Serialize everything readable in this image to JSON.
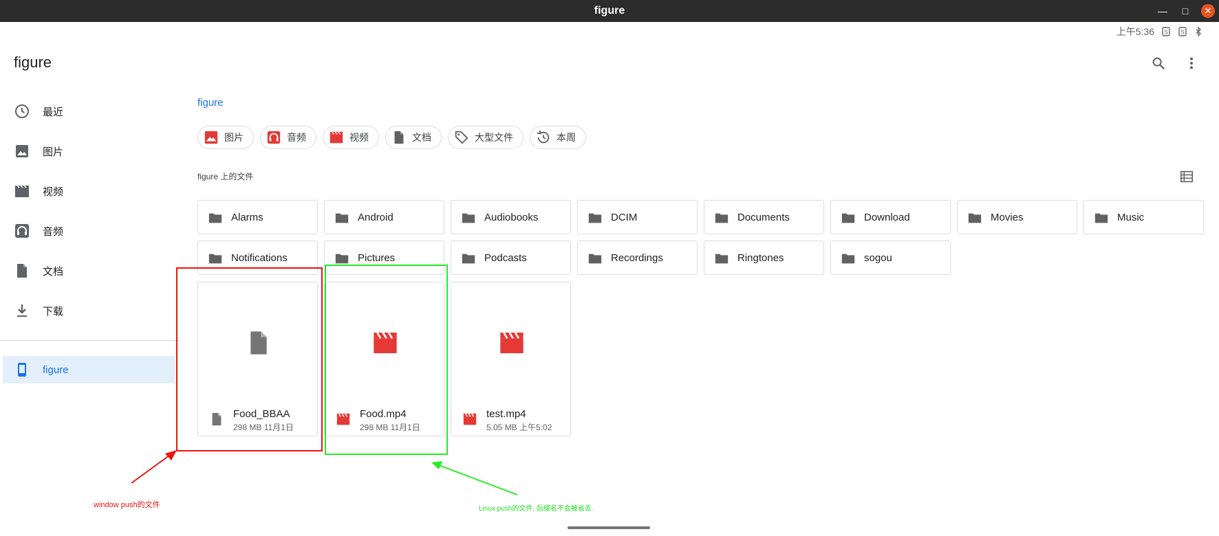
{
  "window": {
    "title": "figure"
  },
  "status": {
    "time": "上午5:36",
    "icon1": "sim-icon",
    "icon2": "sim-icon",
    "icon3": "bluetooth-icon"
  },
  "appbar": {
    "title": "figure",
    "search_icon": "search-icon",
    "more_icon": "more-vert-icon"
  },
  "sidebar": {
    "items": [
      {
        "label": "最近",
        "icon": "clock-icon"
      },
      {
        "label": "图片",
        "icon": "image-icon"
      },
      {
        "label": "视频",
        "icon": "video-icon"
      },
      {
        "label": "音频",
        "icon": "headphones-icon"
      },
      {
        "label": "文档",
        "icon": "document-icon"
      },
      {
        "label": "下载",
        "icon": "download-icon"
      }
    ],
    "device": {
      "label": "figure",
      "icon": "phone-icon"
    }
  },
  "breadcrumb": "figure",
  "chips": [
    {
      "label": "图片",
      "icon": "image-icon",
      "color": "#e53935"
    },
    {
      "label": "音频",
      "icon": "headphones-icon",
      "color": "#e53935"
    },
    {
      "label": "视频",
      "icon": "video-icon",
      "color": "#e53935"
    },
    {
      "label": "文档",
      "icon": "document-icon",
      "color": "#616161"
    },
    {
      "label": "大型文件",
      "icon": "tag-icon",
      "color": "#616161"
    },
    {
      "label": "本周",
      "icon": "history-icon",
      "color": "#616161"
    }
  ],
  "section_label": "figure 上的文件",
  "folders": [
    "Alarms",
    "Android",
    "Audiobooks",
    "DCIM",
    "Documents",
    "Download",
    "Movies",
    "Music",
    "Notifications",
    "Pictures",
    "Podcasts",
    "Recordings",
    "Ringtones",
    "sogou"
  ],
  "files": [
    {
      "name": "Food_BBAA",
      "meta": "298 MB 11月1日",
      "kind": "document"
    },
    {
      "name": "Food.mp4",
      "meta": "298 MB 11月1日",
      "kind": "video"
    },
    {
      "name": "test.mp4",
      "meta": "5.05 MB 上午5:02",
      "kind": "video"
    }
  ],
  "annotations": {
    "red": "window push的文件",
    "green": "Linux push的文件, 后缀名不会被省去."
  },
  "colors": {
    "accent": "#1a73e8",
    "video": "#e53935",
    "folder": "#616161",
    "annot_red": "#ee1111",
    "annot_green": "#22ee22"
  }
}
